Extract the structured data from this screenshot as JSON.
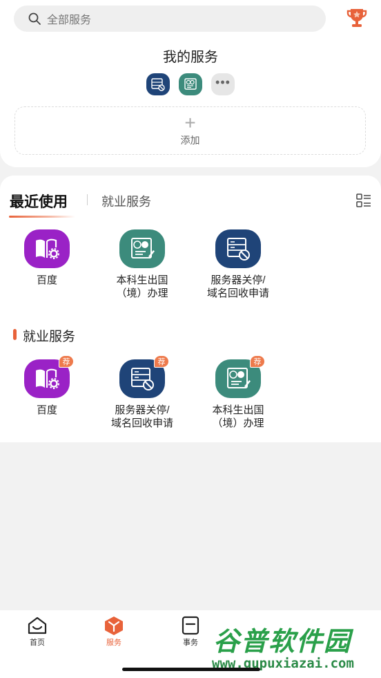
{
  "search": {
    "placeholder": "全部服务"
  },
  "my_services": {
    "title": "我的服务",
    "add_label": "添加",
    "plus_glyph": "+",
    "more_glyph": "•••"
  },
  "tabs": {
    "active": "最近使用",
    "other": "就业服务"
  },
  "recent": [
    {
      "label": "百度",
      "icon": "book-gear-icon",
      "color": "#9a22c6"
    },
    {
      "label": "本科生出国\n（境）办理",
      "icon": "passport-form-icon",
      "color": "#3c8b7c"
    },
    {
      "label": "服务器关停/\n域名回收申请",
      "icon": "server-block-icon",
      "color": "#1f4478"
    }
  ],
  "employment": {
    "title": "就业服务",
    "badge": "荐",
    "items": [
      {
        "label": "百度",
        "icon": "book-gear-icon",
        "color": "#9a22c6"
      },
      {
        "label": "服务器关停/\n域名回收申请",
        "icon": "server-block-icon",
        "color": "#1f4478"
      },
      {
        "label": "本科生出国\n（境）办理",
        "icon": "passport-form-icon",
        "color": "#3c8b7c"
      }
    ]
  },
  "tabbar": [
    {
      "label": "首页",
      "icon": "home-icon",
      "active": false
    },
    {
      "label": "服务",
      "icon": "cube-icon",
      "active": true
    },
    {
      "label": "事务",
      "icon": "clipboard-icon",
      "active": false
    }
  ],
  "watermark": {
    "title": "谷普软件园",
    "url": "www.gupuxiazai.com"
  },
  "colors": {
    "accent": "#e8623a",
    "purple": "#9a22c6",
    "navy": "#1f4478",
    "teal": "#3c8b7c"
  }
}
